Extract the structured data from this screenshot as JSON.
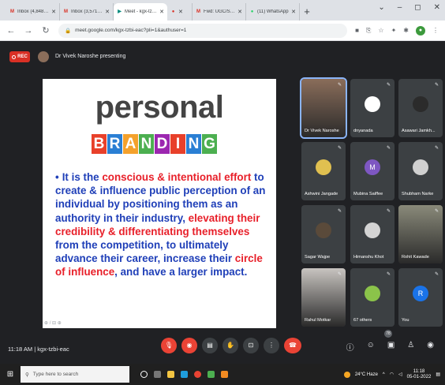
{
  "browser": {
    "tabs": [
      {
        "title": "Inbox (4,848) - dnyaneshwar",
        "fav": "M",
        "fav_color": "#d93025",
        "active": false
      },
      {
        "title": "Inbox (3,571) - rajeshkumar",
        "fav": "M",
        "fav_color": "#d93025",
        "active": false
      },
      {
        "title": "Meet - kgx-tzbi-eac",
        "fav": "▶",
        "fav_color": "#00897b",
        "active": true
      },
      {
        "title": "",
        "fav": "●",
        "fav_color": "#d93025",
        "active": false
      },
      {
        "title": "Fwd: UGC/SPPU/Workshop on Br",
        "fav": "M",
        "fav_color": "#d93025",
        "active": false
      },
      {
        "title": "(11) WhatsApp",
        "fav": "●",
        "fav_color": "#25d366",
        "active": false
      }
    ],
    "url": "meet.google.com/kgx-tzbi-eac?pli=1&authuser=1",
    "window_controls": [
      "⌄",
      "–",
      "◻",
      "✕"
    ]
  },
  "meet": {
    "rec_label": "REC",
    "presenting_text": "Dr Vivek Naroshe presenting",
    "slide": {
      "title": "personal",
      "word_letters": [
        "B",
        "R",
        "A",
        "N",
        "D",
        "I",
        "N",
        "G"
      ],
      "letter_colors": [
        "#e8402a",
        "#2a7fd4",
        "#f4a12c",
        "#4caf50",
        "#9c27b0",
        "#e8402a",
        "#2a7fd4",
        "#4caf50"
      ],
      "body": [
        {
          "t": "It is the ",
          "red": false
        },
        {
          "t": "conscious & intentional effort",
          "red": true
        },
        {
          "t": " to create & influence public perception of an individual by positioning them as an authority in their industry, ",
          "red": false
        },
        {
          "t": "elevating their credibility & differentiating themselves",
          "red": true
        },
        {
          "t": " from the competition, to ultimately advance their career, increase their ",
          "red": false
        },
        {
          "t": "circle of influence",
          "red": true
        },
        {
          "t": ", and have a larger impact.",
          "red": false
        }
      ],
      "controls_text": "⊕ / ⊟ ⊕"
    },
    "participants": [
      {
        "name": "Dr Vivek Naroshe",
        "initial": "",
        "color": "#8a6d5a",
        "video": true,
        "highlight": true
      },
      {
        "name": "dnyanada",
        "initial": "",
        "color": "#ffffff",
        "video": false
      },
      {
        "name": "Asawari Jamkh...",
        "initial": "",
        "color": "#2b2b2b",
        "video": false
      },
      {
        "name": "Ashwini Jangade",
        "initial": "",
        "color": "#e0c050",
        "video": false
      },
      {
        "name": "Mubina Saiffee",
        "initial": "M",
        "color": "#7e57c2",
        "video": false
      },
      {
        "name": "Shubham Narke",
        "initial": "",
        "color": "#d0d0d0",
        "video": false
      },
      {
        "name": "Sagar Wajpe",
        "initial": "",
        "color": "#5a4a3a",
        "video": false
      },
      {
        "name": "Himanshu Khot",
        "initial": "",
        "color": "#d4d4d4",
        "video": false
      },
      {
        "name": "Rohit Kawade",
        "initial": "",
        "color": "#8a8a7a",
        "video": true
      },
      {
        "name": "Rahul Motkar",
        "initial": "",
        "color": "#c8c4c0",
        "video": true
      },
      {
        "name": "67 others",
        "initial": "",
        "color": "#8bc34a",
        "video": false
      },
      {
        "name": "You",
        "initial": "R",
        "color": "#1a73e8",
        "video": false
      }
    ],
    "time": "11:18 AM",
    "code": "kgx-tzbi-eac",
    "people_count": "78"
  },
  "taskbar": {
    "search_placeholder": "Type here to search",
    "weather": "24°C Haze",
    "time": "11:18",
    "date": "05-01-2022"
  }
}
